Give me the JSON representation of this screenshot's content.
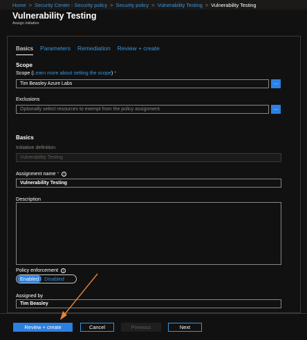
{
  "breadcrumb": {
    "items": [
      "Home",
      "Security Center - Security policy",
      "Security policy",
      "Vulnerability Testing",
      "Vulnerability Testing"
    ],
    "separator": ">"
  },
  "header": {
    "title": "Vulnerability Testing",
    "subtitle": "Assign initiative"
  },
  "tabs": [
    "Basics",
    "Parameters",
    "Remediation",
    "Review + create"
  ],
  "scope_section": {
    "title": "Scope",
    "scope_label": "Scope",
    "scope_link": "Learn more about setting the scope",
    "scope_value": "Tim Beasley Azure Labs",
    "exclusions_label": "Exclusions",
    "exclusions_placeholder": "Optionally select resources to exempt from the policy assignment",
    "browse_label": "..."
  },
  "basics_section": {
    "title": "Basics",
    "initiative_label": "Initiative definition",
    "initiative_value": "Vulnerability Testing",
    "assignment_name_label": "Assignment name",
    "assignment_name_value": "Vulnerability Testing",
    "description_label": "Description",
    "policy_enforcement_label": "Policy enforcement",
    "enabled_label": "Enabled",
    "disabled_label": "Disabled",
    "assigned_by_label": "Assigned by",
    "assigned_by_value": "Tim Beasley"
  },
  "footer": {
    "review_create": "Review + create",
    "cancel": "Cancel",
    "previous": "Previous",
    "next": "Next"
  },
  "colors": {
    "accent": "#2c80e0",
    "link": "#3a96dd",
    "annotation_arrow": "#e8823a",
    "background": "#111111"
  }
}
